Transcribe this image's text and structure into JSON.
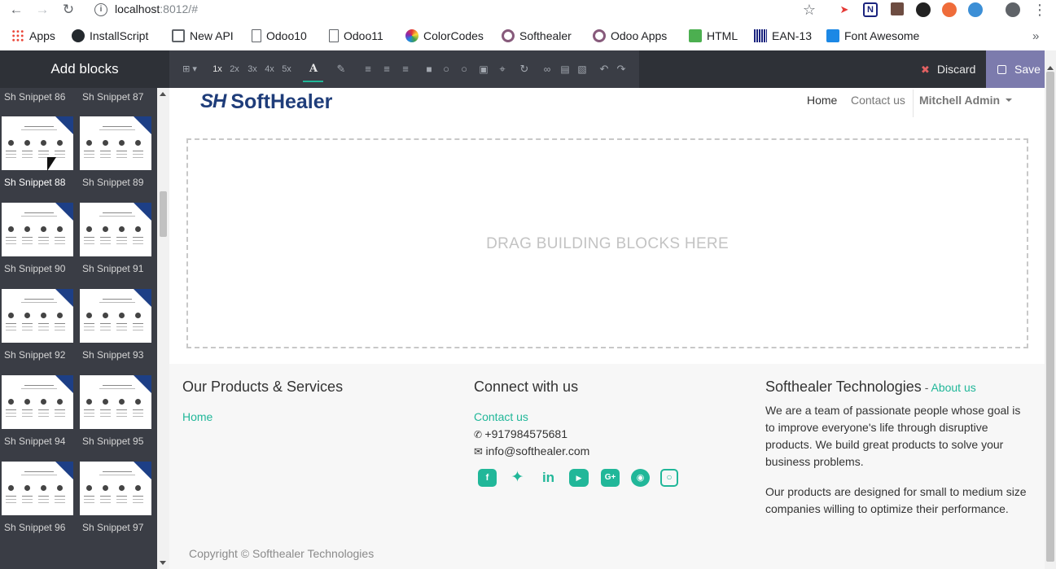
{
  "browser": {
    "url_host": "localhost",
    "url_rest": ":8012/#",
    "bookmarks": [
      {
        "label": "Apps",
        "icon": "apps-grid-icon",
        "color": "#ea4335"
      },
      {
        "label": "InstallScript",
        "icon": "github-icon",
        "color": "#24292e"
      },
      {
        "label": "New API",
        "icon": "book-icon",
        "color": "#5f6368"
      },
      {
        "label": "Odoo10",
        "icon": "page-icon",
        "color": "#5f6368"
      },
      {
        "label": "Odoo11",
        "icon": "page-icon",
        "color": "#5f6368"
      },
      {
        "label": "ColorCodes",
        "icon": "color-wheel-icon",
        "color": "#e53935"
      },
      {
        "label": "Softhealer",
        "icon": "odoo-circle-icon",
        "color": "#875a7b"
      },
      {
        "label": "Odoo Apps",
        "icon": "odoo-circle-icon",
        "color": "#875a7b"
      },
      {
        "label": "HTML",
        "icon": "html-icon",
        "color": "#4caf50"
      },
      {
        "label": "EAN-13",
        "icon": "barcode-icon",
        "color": "#1a237e"
      },
      {
        "label": "Font Awesome",
        "icon": "flag-icon",
        "color": "#1c88e5"
      }
    ]
  },
  "editor": {
    "sidebar_title": "Add blocks",
    "zoom_levels": [
      "1x",
      "2x",
      "3x",
      "4x",
      "5x"
    ],
    "discard_label": "Discard",
    "save_label": "Save",
    "accent_color": "#21b799"
  },
  "snippets": [
    {
      "label": "Sh Snippet 86"
    },
    {
      "label": "Sh Snippet 87"
    },
    {
      "label": "Sh Snippet 88"
    },
    {
      "label": "Sh Snippet 89"
    },
    {
      "label": "Sh Snippet 90"
    },
    {
      "label": "Sh Snippet 91"
    },
    {
      "label": "Sh Snippet 92"
    },
    {
      "label": "Sh Snippet 93"
    },
    {
      "label": "Sh Snippet 94"
    },
    {
      "label": "Sh Snippet 95"
    },
    {
      "label": "Sh Snippet 96"
    },
    {
      "label": "Sh Snippet 97"
    }
  ],
  "site": {
    "logo_mark": "SH",
    "logo_text": "SoftHealer",
    "nav": {
      "home": "Home",
      "contact": "Contact us",
      "user": "Mitchell Admin"
    },
    "dropzone_text": "DRAG BUILDING BLOCKS HERE",
    "footer": {
      "col1_title": "Our Products & Services",
      "col1_link": "Home",
      "col2_title": "Connect with us",
      "col2_link": "Contact us",
      "phone": "+917984575681",
      "email": "info@softhealer.com",
      "col3_title": "Softhealer Technologies",
      "col3_dash": " - ",
      "col3_link": "About us",
      "para1": "We are a team of passionate people whose goal is to improve everyone's life through disruptive products. We build great products to solve your business problems.",
      "para2": "Our products are designed for small to medium size companies willing to optimize their performance.",
      "social": [
        "facebook-icon",
        "twitter-icon",
        "linkedin-icon",
        "youtube-icon",
        "google-plus-icon",
        "github-icon",
        "instagram-icon"
      ],
      "copyright": "Copyright © Softhealer Technologies"
    }
  }
}
